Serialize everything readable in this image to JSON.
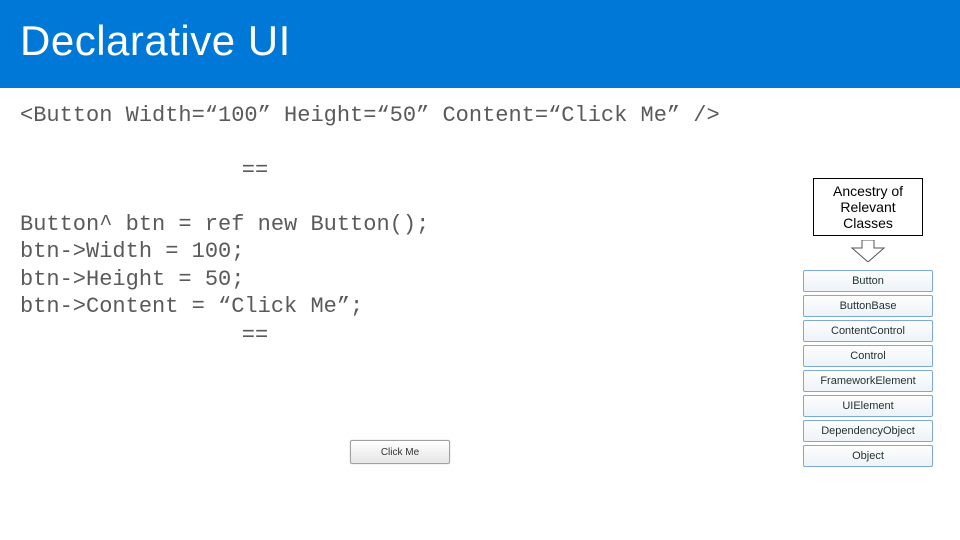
{
  "header": {
    "title": "Declarative UI"
  },
  "xaml_line": "<Button Width=“100” Height=“50” Content=“Click Me” />",
  "eq1": "==",
  "cpp_block": "Button^ btn = ref new Button();\nbtn->Width = 100;\nbtn->Height = 50;\nbtn->Content = “Click Me”;",
  "eq2": "==",
  "demo_button_label": "Click Me",
  "ancestry": {
    "title": "Ancestry of Relevant Classes",
    "items": [
      "Button",
      "ButtonBase",
      "ContentControl",
      "Control",
      "FrameworkElement",
      "UIElement",
      "DependencyObject",
      "Object"
    ]
  }
}
